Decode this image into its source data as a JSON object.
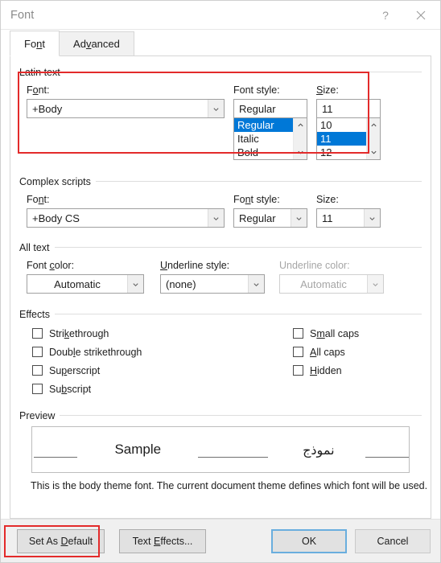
{
  "window": {
    "title": "Font",
    "help_icon": "question-mark-icon",
    "close_icon": "close-icon"
  },
  "tabs": [
    {
      "label_pre": "Fo",
      "label_accel": "n",
      "label_post": "t",
      "active": true
    },
    {
      "label_pre": "Ad",
      "label_accel": "v",
      "label_post": "anced",
      "active": false
    }
  ],
  "latin_text": {
    "group_label": "Latin text",
    "font": {
      "label_pre": "F",
      "label_accel": "o",
      "label_post": "nt:",
      "value": "+Body"
    },
    "font_style": {
      "label": "Font style:",
      "value": "Regular",
      "options": [
        "Regular",
        "Italic",
        "Bold"
      ],
      "selected": "Regular"
    },
    "size": {
      "label_accel": "S",
      "label_post": "ize:",
      "value": "11",
      "options": [
        "10",
        "11",
        "12"
      ],
      "selected": "11"
    }
  },
  "complex_scripts": {
    "group_label": "Complex scripts",
    "font": {
      "label_pre": "Fo",
      "label_accel": "n",
      "label_post": "t:",
      "value": "+Body CS"
    },
    "font_style": {
      "label_pre": "Fo",
      "label_accel": "n",
      "label_post": "t style:",
      "value": "Regular"
    },
    "size": {
      "label": "Size:",
      "value": "11"
    }
  },
  "all_text": {
    "group_label": "All text",
    "font_color": {
      "label_pre": "Font ",
      "label_accel": "c",
      "label_post": "olor:",
      "value": "Automatic",
      "disabled": false
    },
    "underline_style": {
      "label_accel": "U",
      "label_post": "nderline style:",
      "value": "(none)",
      "disabled": false
    },
    "underline_color": {
      "label": "Underline color:",
      "value": "Automatic",
      "disabled": true
    }
  },
  "effects": {
    "group_label": "Effects",
    "left_column": [
      {
        "label_pre": "Stri",
        "label_accel": "k",
        "label_post": "ethrough",
        "checked": false
      },
      {
        "label_pre": "Doub",
        "label_accel": "l",
        "label_post": "e strikethrough",
        "checked": false
      },
      {
        "label_pre": "Su",
        "label_accel": "p",
        "label_post": "erscript",
        "checked": false
      },
      {
        "label_pre": "Su",
        "label_accel": "b",
        "label_post": "script",
        "checked": false
      }
    ],
    "right_column": [
      {
        "label_pre": "S",
        "label_accel": "m",
        "label_post": "all caps",
        "checked": false
      },
      {
        "label_pre": "",
        "label_accel": "A",
        "label_post": "ll caps",
        "checked": false
      },
      {
        "label_pre": "",
        "label_accel": "H",
        "label_post": "idden",
        "checked": false
      }
    ]
  },
  "preview": {
    "group_label": "Preview",
    "sample_latin": "Sample",
    "sample_complex": "نموذج",
    "note": "This is the body theme font. The current document theme defines which font will be used."
  },
  "footer": {
    "set_as_default": {
      "pre": "Set As ",
      "accel": "D",
      "post": "efault"
    },
    "text_effects": {
      "pre": "Text ",
      "accel": "E",
      "post": "ffects..."
    },
    "ok": "OK",
    "cancel": "Cancel"
  },
  "annotations": {
    "highlight_color": "#e32b2b",
    "boxes": [
      "latin-text-fields",
      "set-as-default-button"
    ]
  }
}
